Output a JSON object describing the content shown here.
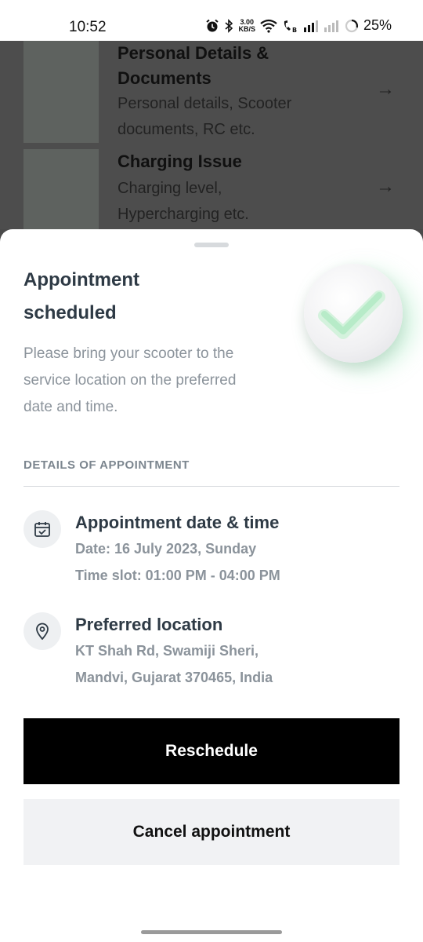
{
  "status_bar": {
    "time": "10:52",
    "net_speed_top": "3.00",
    "net_speed_bottom": "KB/S",
    "battery": "25%"
  },
  "background_list": [
    {
      "title": "Personal Details & Documents",
      "subtitle": "Personal details, Scooter documents, RC etc."
    },
    {
      "title": "Charging Issue",
      "subtitle": "Charging level, Hypercharging etc."
    }
  ],
  "sheet": {
    "title": "Appointment scheduled",
    "description": "Please bring your scooter to the service location on the preferred date and time.",
    "section_label": "DETAILS OF APPOINTMENT",
    "appointment": {
      "title": "Appointment date & time",
      "date": "Date: 16 July 2023, Sunday",
      "slot": "Time slot: 01:00 PM - 04:00 PM"
    },
    "location": {
      "title": "Preferred location",
      "line1": "KT Shah Rd, Swamiji Sheri,",
      "line2": "Mandvi, Gujarat 370465, India"
    },
    "reschedule_label": "Reschedule",
    "cancel_label": "Cancel appointment"
  },
  "icons": {
    "appointment": "calendar-check-icon",
    "location": "location-pin-icon",
    "success": "checkmark-icon"
  }
}
